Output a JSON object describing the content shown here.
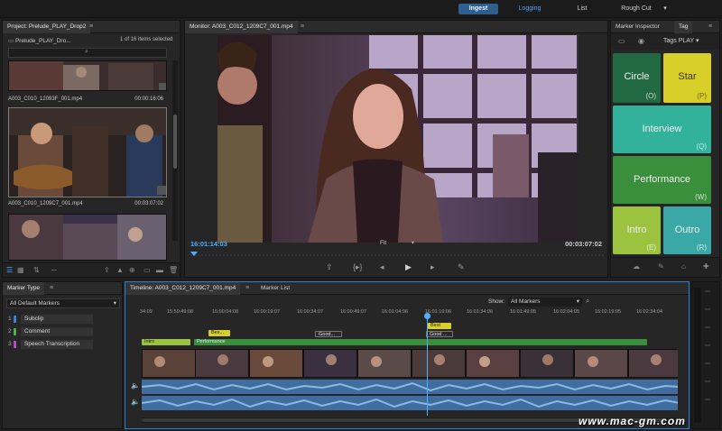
{
  "workspace": {
    "ingest": "Ingest",
    "logging": "Logging",
    "list": "List",
    "rough_cut": "Rough Cut",
    "menu_arrow": "▾"
  },
  "project": {
    "tab_title": "Project: Prelude_PLAY_Drop2",
    "breadcrumb": "Prelude_PLAY_Dro...",
    "selection_count": "1 of 16 items selected",
    "clips": [
      {
        "name": "A003_C010_12093F_001.mp4",
        "duration": "00:00:16:06"
      },
      {
        "name": "A003_C010_1209C7_001.mp4",
        "duration": "00:03:07:02"
      }
    ]
  },
  "monitor": {
    "tab_title": "Monitor: A003_C012_1209C7_001.mp4",
    "current_timecode": "16:01:14:03",
    "duration_timecode": "00:03:07:02",
    "zoom": "Fit"
  },
  "tags": {
    "tab_inspector": "Marker Inspector",
    "tab_tag": "Tag",
    "preset": "Tags PLAY",
    "buttons": [
      {
        "name": "Circle",
        "key": "(O)",
        "color": "#236a42"
      },
      {
        "name": "Star",
        "key": "(P)",
        "color": "#d9cf2a"
      },
      {
        "name": "Interview",
        "key": "(Q)",
        "color": "#33b29b"
      },
      {
        "name": "Performance",
        "key": "(W)",
        "color": "#3a8f3c"
      },
      {
        "name": "Intro",
        "key": "(E)",
        "color": "#9bc33f"
      },
      {
        "name": "Outro",
        "key": "(R)",
        "color": "#3aa8a6"
      }
    ]
  },
  "marker_type": {
    "tab_title": "Marker Type",
    "preset": "All Default Markers",
    "items": [
      {
        "num": "1",
        "label": "Subclip",
        "color": "#3f7fd6"
      },
      {
        "num": "2",
        "label": "Comment",
        "color": "#4cae4c"
      },
      {
        "num": "3",
        "label": "Speech Transcription",
        "color": "#b04fc0"
      }
    ]
  },
  "timeline": {
    "tab_title": "Timeline: A003_C012_1209C7_001.mp4",
    "tab_marker_list": "Marker List",
    "show_label": "Show:",
    "show_value": "All Markers",
    "ruler_ticks": [
      "34:09",
      "15:59:49:08",
      "16:00:04:08",
      "16:00:19:07",
      "16:00:34:07",
      "16:00:49:07",
      "16:01:04:06",
      "16:01:19:06",
      "16:01:34:06",
      "16:01:49:05",
      "16:02:04:05",
      "16:02:19:05",
      "16:02:34:04"
    ],
    "markers": {
      "intro": "Intro",
      "performance": "Performance",
      "best1": "Bes...",
      "best2": "Best",
      "good1": "Good...",
      "good2": "Good ..."
    }
  },
  "watermark": "www.mac-gm.com"
}
